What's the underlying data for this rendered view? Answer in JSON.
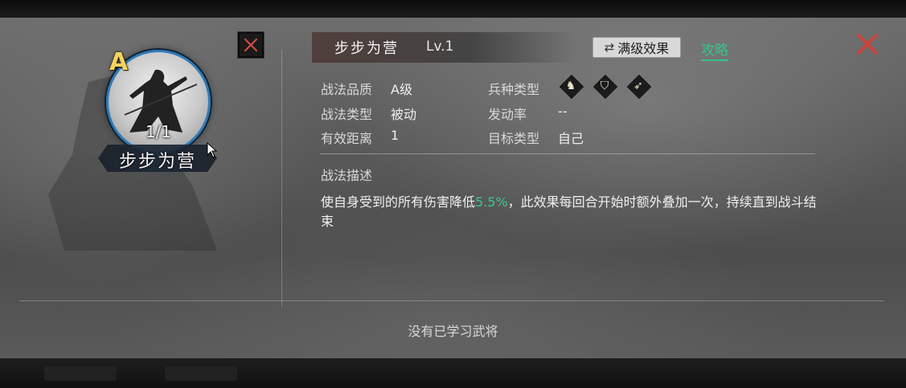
{
  "skill": {
    "name": "步步为营",
    "level": "Lv.1",
    "grade_letter": "A",
    "count": "1/1",
    "portrait_icon": "warrior-portrait"
  },
  "header": {
    "max_effect_label": "满级效果",
    "max_effect_icon": "swap-arrows-icon",
    "guide_label": "攻略",
    "close_icon": "close-x-icon"
  },
  "info": {
    "quality_label": "战法品质",
    "quality_value": "A级",
    "type_label": "战法类型",
    "type_value": "被动",
    "range_label": "有效距离",
    "range_value": "1",
    "troop_label": "兵种类型",
    "troop_icons": [
      "cavalry-icon",
      "shield-infantry-icon",
      "archer-icon"
    ],
    "rate_label": "发动率",
    "rate_value": "--",
    "target_label": "目标类型",
    "target_value": "自己"
  },
  "description": {
    "heading": "战法描述",
    "text_before": "使自身受到的所有伤害降低",
    "highlight": "5.5%",
    "text_after": "，此效果每回合开始时额外叠加一次，持续直到战斗结束",
    "highlight_color": "#38c98c"
  },
  "footer": {
    "no_generals": "没有已学习武将"
  },
  "colors": {
    "accent_close": "#c9443a",
    "guide_green": "#36c48a",
    "grade_gold": "#f6d25c",
    "portrait_ring": "#2f7ab8"
  }
}
